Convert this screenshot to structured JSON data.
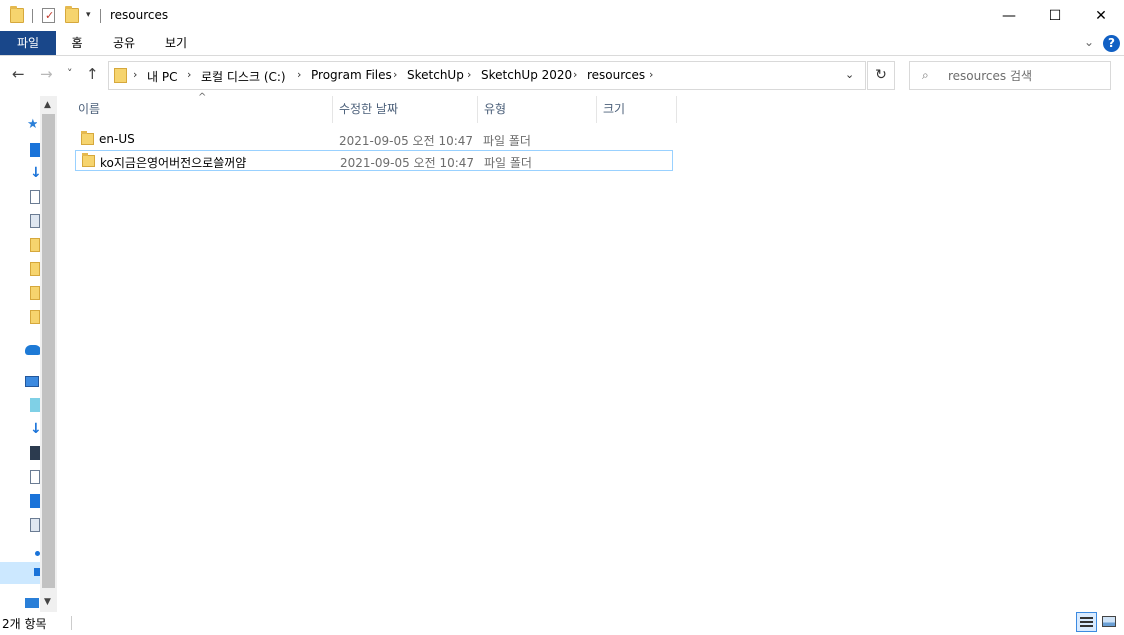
{
  "window": {
    "title": "resources",
    "controls": {
      "minimize": "—",
      "maximize": "☐",
      "close": "✕"
    }
  },
  "ribbon": {
    "tabs": [
      {
        "label": "파일",
        "active": true
      },
      {
        "label": "홈"
      },
      {
        "label": "공유"
      },
      {
        "label": "보기"
      }
    ],
    "help": "?",
    "expand": "⌄"
  },
  "navigation": {
    "back": "←",
    "forward": "→",
    "recent": "˅",
    "up": "↑",
    "breadcrumb_separator": "›",
    "breadcrumbs": [
      "내 PC",
      "로컬 디스크 (C:)",
      "Program Files",
      "SketchUp",
      "SketchUp 2020",
      "resources"
    ],
    "dropdown": "⌄",
    "refresh": "↻"
  },
  "search": {
    "placeholder": "resources 검색",
    "icon": "⌕"
  },
  "columns": {
    "name": "이름",
    "modified": "수정한 날짜",
    "type": "유형",
    "size": "크기",
    "sort_indicator": "^"
  },
  "files": [
    {
      "name": "en-US",
      "modified": "2021-09-05 오전 10:47",
      "type": "파일 폴더",
      "size": ""
    },
    {
      "name": "ko지금은영어버전으로쓸꺼얌",
      "modified": "2021-09-05 오전 10:47",
      "type": "파일 폴더",
      "size": ""
    }
  ],
  "statusbar": {
    "item_count": "2개 항목"
  },
  "colors": {
    "file_tab": "#19478a",
    "help": "#1160c4",
    "focus_border": "#99d1ff",
    "folder": "#f6d46e"
  }
}
